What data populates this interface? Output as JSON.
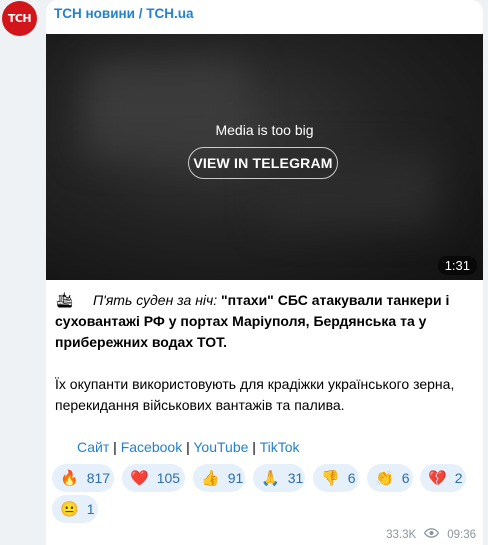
{
  "channel": {
    "avatar_text": "ТСН",
    "name": "ТСН новини / TCH.ua"
  },
  "media": {
    "message": "Media is too big",
    "button": "VIEW IN TELEGRAM",
    "duration": "1:31"
  },
  "post": {
    "italic_lead": "П'ять суден за ніч:",
    "bold_text": "\"птахи\" СБС атакували танкери і суховантажі РФ у портах Маріуполя, Бердянська та у прибережних водах ТОТ.",
    "paragraph2": "Їх окупанти використовують для крадіжки українського зерна, перекидання військових вантажів та палива.",
    "links": [
      "Сайт",
      "Facebook",
      "YouTube",
      "TikTok"
    ],
    "link_separator": " | "
  },
  "reactions": [
    {
      "emoji": "🔥",
      "count": "817"
    },
    {
      "emoji": "❤️",
      "count": "105"
    },
    {
      "emoji": "👍",
      "count": "91"
    },
    {
      "emoji": "🙏",
      "count": "31"
    },
    {
      "emoji": "👎",
      "count": "6"
    },
    {
      "emoji": "👏",
      "count": "6"
    },
    {
      "emoji": "💔",
      "count": "2"
    },
    {
      "emoji": "😐",
      "count": "1"
    }
  ],
  "meta": {
    "views": "33.3K",
    "time": "09:36"
  },
  "colors": {
    "link": "#2481cc",
    "avatar_bg": "#d2141b",
    "reaction_bg": "#e6f0fa"
  }
}
